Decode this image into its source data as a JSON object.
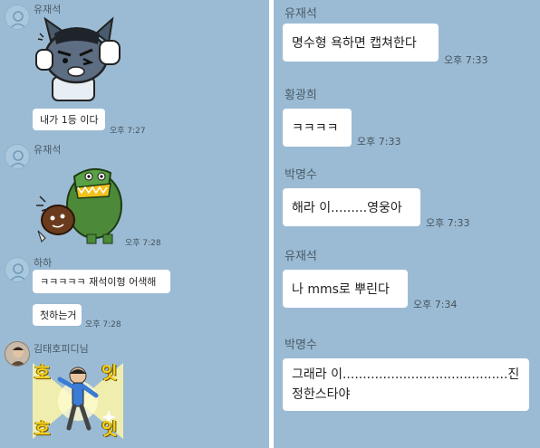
{
  "left_panel": {
    "messages": [
      {
        "sender": "유재석",
        "type": "sticker",
        "sticker": "muzi-angry-sticker"
      },
      {
        "type": "text",
        "text": "내가 1등 이다",
        "time": "오후 7:27"
      },
      {
        "sender": "유재석",
        "type": "sticker",
        "sticker": "crocodile-eating-sticker",
        "time": "오후 7:28"
      },
      {
        "sender": "하하",
        "type": "text",
        "text": "ㅋㅋㅋㅋㅋ 재석이형 어색해"
      },
      {
        "type": "text",
        "text": "첫하는거",
        "time": "오후 7:28"
      },
      {
        "sender": "김태호피디님",
        "type": "sticker",
        "sticker": "dancing-ho-it-sticker",
        "sticker_text": [
          "호",
          "잇",
          "호",
          "잇"
        ]
      }
    ]
  },
  "right_panel": {
    "messages": [
      {
        "sender": "유재석",
        "text": "명수형 욕하면 캡쳐한다",
        "time": "오후 7:33"
      },
      {
        "sender": "황광희",
        "text": "ㅋㅋㅋㅋ",
        "time": "오후 7:33"
      },
      {
        "sender": "박명수",
        "text": "해라 이.........영웅아",
        "time": "오후 7:33"
      },
      {
        "sender": "유재석",
        "text": "나 mms로 뿌린다",
        "time": "오후 7:34"
      },
      {
        "sender": "박명수",
        "text_line1": "그래라  이.........................................진",
        "text_line2": "정한스타야"
      }
    ]
  },
  "colors": {
    "chat_background": "#9bbbd4",
    "bubble": "#ffffff",
    "divider": "#ffffff"
  }
}
